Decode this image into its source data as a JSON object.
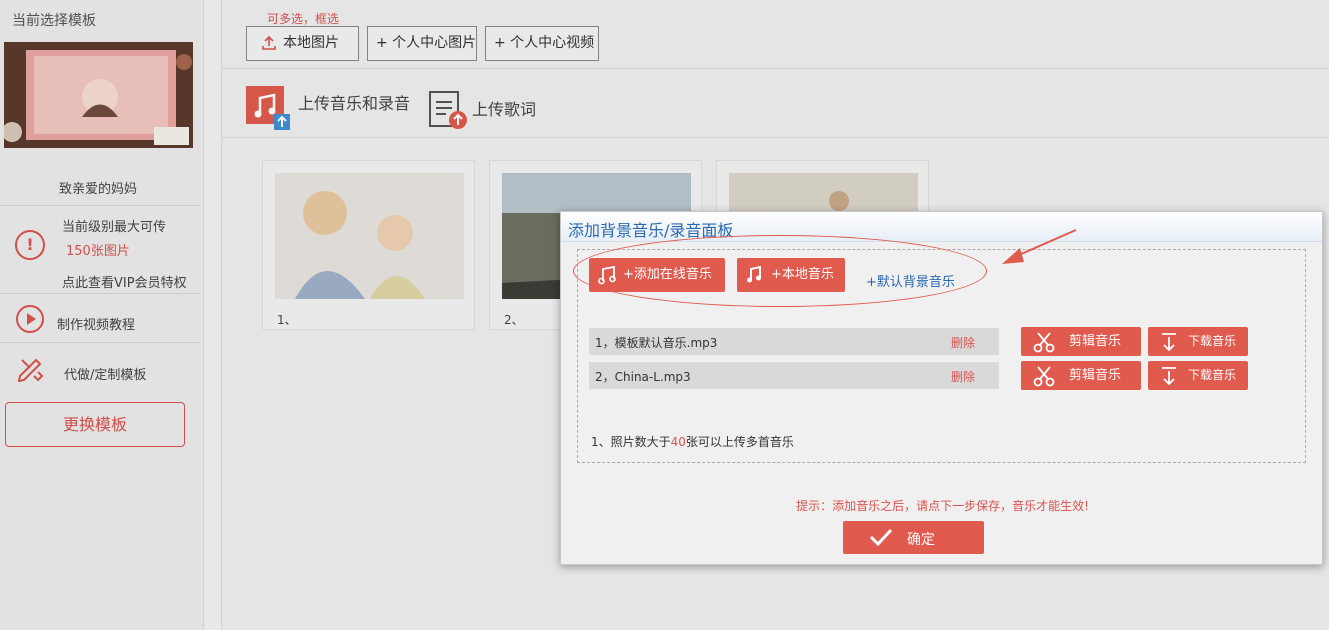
{
  "sidebar": {
    "title": "当前选择模板",
    "template_name": "致亲爱的妈妈",
    "level_line1": "当前级别最大可传",
    "level_line2": "150张图片",
    "vip_link": "点此查看VIP会员特权",
    "video_tutorial": "制作视频教程",
    "custom_template": "代做/定制模板",
    "change_template": "更换模板"
  },
  "toolbar": {
    "hint": "可多选，框选",
    "local_photos": "本地图片",
    "center_photos": "+ 个人中心图片",
    "center_videos": "+ 个人中心视频"
  },
  "upload": {
    "music_label": "上传音乐和录音",
    "lyrics_label": "上传歌词"
  },
  "photos": [
    {
      "caption": "1、"
    },
    {
      "caption": "2、"
    },
    {
      "caption": ""
    }
  ],
  "dialog": {
    "title": "添加背景音乐/录音面板",
    "add_online": "+添加在线音乐",
    "add_local": "+本地音乐",
    "default_bg": "+默认背景音乐",
    "files": [
      {
        "name": "1，模板默认音乐.mp3",
        "delete": "删除",
        "edit": "剪辑音乐",
        "download": "下载音乐"
      },
      {
        "name": "2，China-L.mp3",
        "delete": "删除",
        "edit": "剪辑音乐",
        "download": "下载音乐"
      }
    ],
    "note_prefix": "1、照片数大于",
    "note_num": "40",
    "note_suffix": "张可以上传多首音乐",
    "tip": "提示：添加音乐之后，请点下一步保存，音乐才能生效!",
    "ok": "确定"
  },
  "colors": {
    "accent": "#e05a4e",
    "link": "#2a6ab0"
  }
}
